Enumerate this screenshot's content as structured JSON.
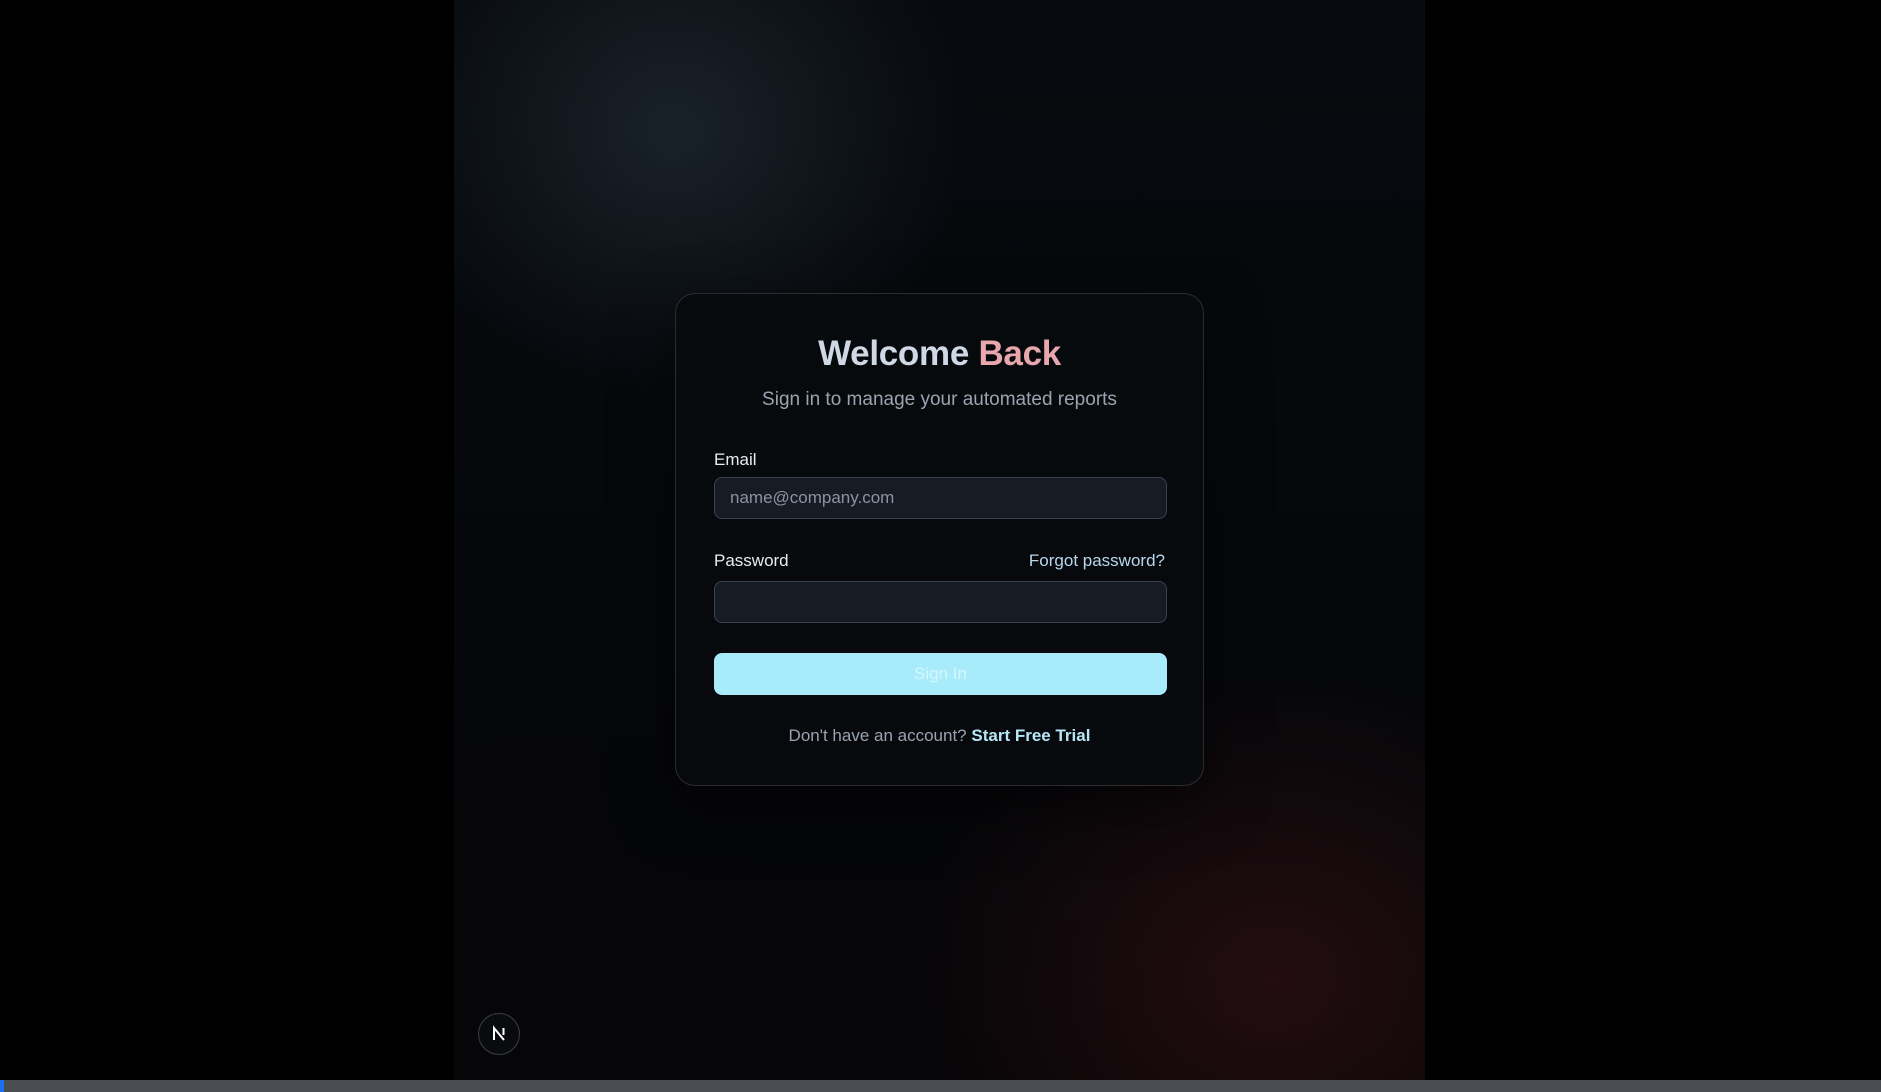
{
  "login": {
    "title_part1": "Welcome",
    "title_part2": "Back",
    "subtitle": "Sign in to manage your automated reports",
    "email_label": "Email",
    "email_placeholder": "name@company.com",
    "email_value": "",
    "password_label": "Password",
    "password_value": "",
    "forgot_password": "Forgot password?",
    "sign_in_label": "Sign In",
    "footer_text": "Don't have an account?",
    "footer_link": "Start Free Trial"
  },
  "badge": {
    "icon": "nextjs-logo-icon",
    "letter": "N"
  },
  "colors": {
    "title_primary": "#cfd9e6",
    "title_accent": "#e8a7ad",
    "button_background": "#a8ecfb",
    "link": "#b7d8ec"
  }
}
